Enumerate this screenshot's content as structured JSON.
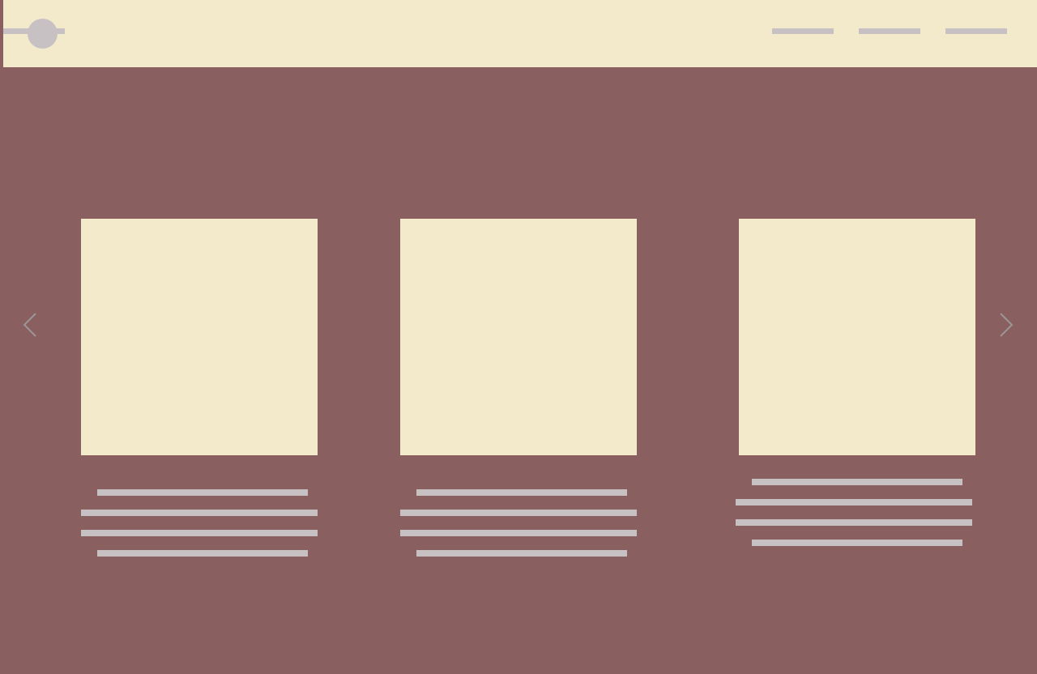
{
  "header": {
    "logo": {
      "shape": "circle-placeholder",
      "color": "#c7c1c4"
    },
    "nav_items": [
      {
        "label": ""
      },
      {
        "label": ""
      },
      {
        "label": ""
      },
      {
        "label": ""
      }
    ]
  },
  "carousel": {
    "prev_icon": "chevron-left-icon",
    "next_icon": "chevron-right-icon",
    "cards": [
      {
        "image": "image-placeholder",
        "text_lines": 4
      },
      {
        "image": "image-placeholder",
        "text_lines": 4
      },
      {
        "image": "image-placeholder",
        "text_lines": 4
      }
    ]
  },
  "colors": {
    "background": "#895f60",
    "surface": "#f3e9cb",
    "placeholder": "#c7c1c4",
    "arrow": "#9c9597"
  }
}
